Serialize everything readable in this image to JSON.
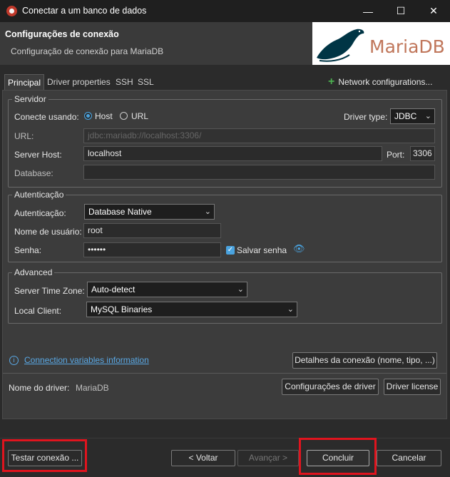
{
  "window": {
    "title": "Conectar a um banco de dados"
  },
  "header": {
    "title": "Configurações de conexão",
    "subtitle": "Configuração de conexão para MariaDB",
    "logo_text": "MariaDB"
  },
  "tabs": [
    {
      "label": "Principal",
      "active": true
    },
    {
      "label": "Driver properties"
    },
    {
      "label": "SSH"
    },
    {
      "label": "SSL"
    }
  ],
  "network_configurations": "Network configurations...",
  "server": {
    "group_title": "Servidor",
    "connect_by_label": "Conecte usando:",
    "option_host": "Host",
    "option_url": "URL",
    "driver_type_label": "Driver type:",
    "driver_type_value": "JDBC",
    "url_label": "URL:",
    "url_value": "jdbc:mariadb://localhost:3306/",
    "host_label": "Server Host:",
    "host_value": "localhost",
    "port_label": "Port:",
    "port_value": "3306",
    "database_label": "Database:",
    "database_value": ""
  },
  "auth": {
    "group_title": "Autenticação",
    "auth_label": "Autenticação:",
    "auth_value": "Database Native",
    "user_label": "Nome de usuário:",
    "user_value": "root",
    "password_label": "Senha:",
    "password_value": "••••••",
    "save_password_label": "Salvar senha"
  },
  "advanced": {
    "group_title": "Advanced",
    "timezone_label": "Server Time Zone:",
    "timezone_value": "Auto-detect",
    "client_label": "Local Client:",
    "client_value": "MySQL Binaries"
  },
  "connection_vars_link": "Connection variables information",
  "connection_details_button": "Detalhes da conexão (nome, tipo, ...)",
  "driver": {
    "name_label": "Nome do driver:",
    "name_value": "MariaDB",
    "settings_button": "Configurações de driver",
    "license_button": "Driver license"
  },
  "footer": {
    "test_button": "Testar conexão ...",
    "back_button": "< Voltar",
    "next_button": "Avançar >",
    "finish_button": "Concluir",
    "cancel_button": "Cancelar"
  },
  "colors": {
    "accent": "#4aa3df",
    "highlight_box": "#e0141e",
    "logo_text": "#c0765a"
  }
}
